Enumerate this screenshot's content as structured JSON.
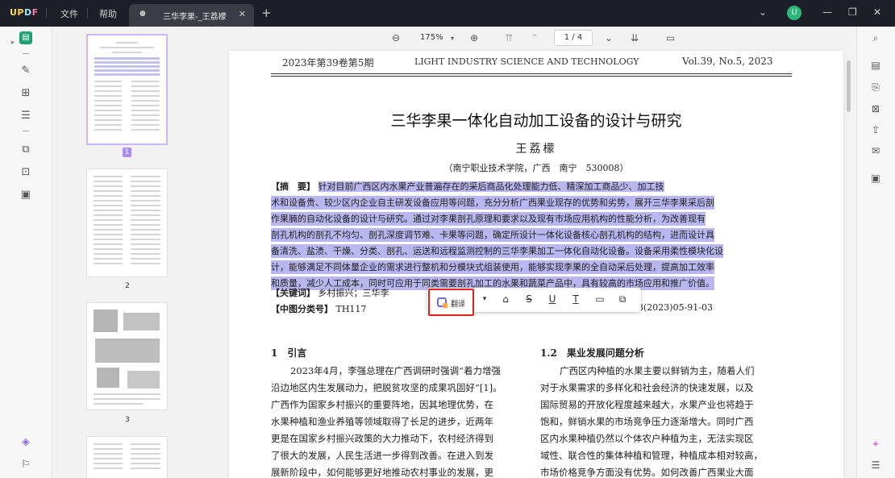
{
  "app": {
    "menu_file": "文件",
    "menu_help": "帮助",
    "tab_title": "三华李果-_王荔檬",
    "user_initial": "U"
  },
  "viewer": {
    "zoom": "175%",
    "page_indicator": "1 / 4"
  },
  "thumbnails": [
    {
      "page": "1"
    },
    {
      "page": "2"
    },
    {
      "page": "3"
    }
  ],
  "document": {
    "header_left": "2023年第39卷第5期",
    "header_center": "LIGHT INDUSTRY SCIENCE AND TECHNOLOGY",
    "header_right": "Vol.39, No.5, 2023",
    "title": "三华李果一体化自动加工设备的设计与研究",
    "author": "王荔檬",
    "affiliation": "（南宁职业技术学院，广西　南宁　530008）",
    "abstract_label": "【摘　要】",
    "abstract_lines": [
      "针对目前广西区内水果产业普遍存在的采后商品化处理能力低、精深加工商品少、加工技",
      "术和设备贵、较少区内企业自主研发设备应用等问题，充分分析广西果业现存的优势和劣势，展开三华李果采后剖",
      "作果腩的自动化设备的设计与研究。通过对李果剖孔原理和要求以及现有市场应用机构的性能分析，为改善现有",
      "剖孔机构的剖孔不均匀、剖孔深度调节难、卡果等问题，确定所设计一体化设备核心剖孔机构的结构，进而设计具",
      "备清洗、盐渍、干燥、分类、剖孔、运送和远程监测控制的三华李果加工一体化自动化设备。设备采用柔性模块化设",
      "计，能够满足不同体量企业的需求进行整机和分模块式组装使用，能够实现李果的全自动采后处理，提高加工效率",
      "和质量，减少人工成本，同时可应用于同类需要剖孔加工的水果和蔬菜产品中，具有较高的市场应用和推广价值。"
    ],
    "keywords_label": "【关键词】",
    "keywords_visible": "乡村振兴；三华李",
    "class_label": "【中图分类号】",
    "class_value": "TH117",
    "article_id_tail": "3(2023)05-91-03",
    "section1_title": "1　引言",
    "section1_lines": [
      "2023年4月，李强总理在广西调研时强调“着力增强",
      "沿边地区内生发展动力，把脱贫攻坚的成果巩固好”[1]。",
      "广西作为国家乡村振兴的重要阵地，因其地理优势，在",
      "水果种植和渔业养殖等领域取得了长足的进步，近两年",
      "更是在国家乡村振兴政策的大力推动下，农村经济得到",
      "了很大的发展，人民生活进一步得到改善。在进入到发",
      "展新阶段中，如何能够更好地推动农村事业的发展，更"
    ],
    "section12_title": "1.2　果业发展问题分析",
    "section12_lines": [
      "广西区内种植的水果主要以鲜销为主，随着人们",
      "对于水果需求的多样化和社会经济的快速发展，以及",
      "国际贸易的开放化程度越来越大，水果产业也将趋于",
      "饱和，鲜销水果的市场竞争压力逐渐增大。同时广西",
      "区内水果种植仍然以个体农户种植为主，无法实现区",
      "域性、联合性的集体种植和管理，种植成本相对较高，",
      "市场价格竞争方面没有优势。如何改善广西果业大面"
    ]
  },
  "popup": {
    "translate_label": "翻译"
  },
  "colors": {
    "selection": "#b9b6f0",
    "accent_green": "#1e9f74",
    "highlight_box": "#e2231a"
  }
}
